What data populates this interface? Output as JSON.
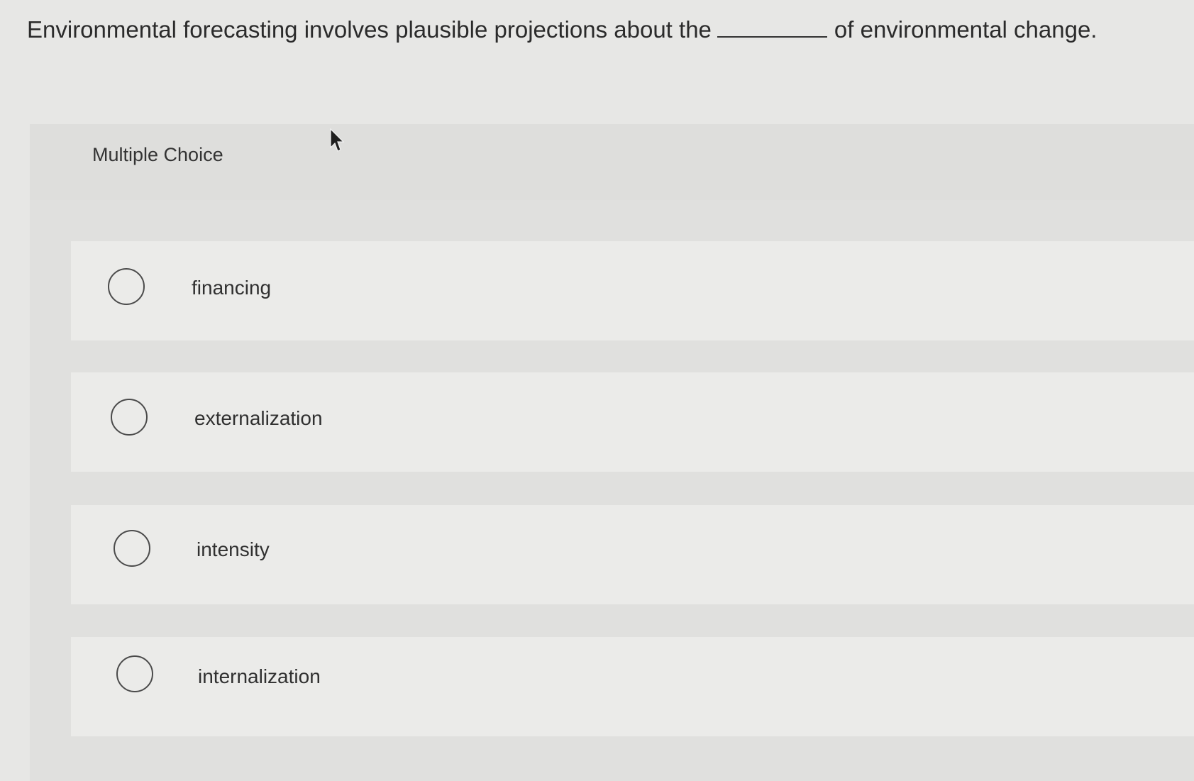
{
  "question": {
    "before_blank": "Environmental forecasting involves plausible projections about the",
    "after_blank": "of environmental change."
  },
  "panel": {
    "title": "Multiple Choice"
  },
  "options": [
    {
      "label": "financing"
    },
    {
      "label": "externalization"
    },
    {
      "label": "intensity"
    },
    {
      "label": "internalization"
    }
  ],
  "icons": {
    "cursor": "mouse-pointer-icon",
    "radio": "radio-circle-icon"
  }
}
